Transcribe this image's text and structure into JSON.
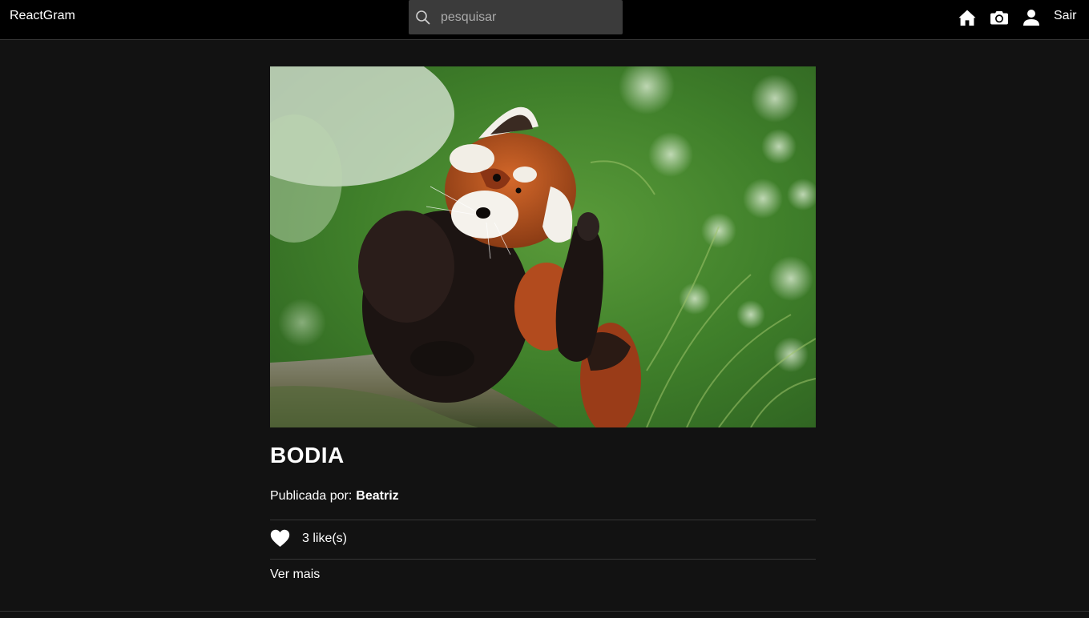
{
  "navbar": {
    "brand": "ReactGram",
    "search_placeholder": "pesquisar",
    "search_value": "",
    "icons": [
      "home-icon",
      "camera-icon",
      "user-icon"
    ],
    "logout_label": "Sair"
  },
  "photo": {
    "image_subject": "red-panda",
    "title": "BODIA",
    "posted_by_label": "Publicada por:",
    "author": "Beatriz",
    "likes_text": "3 like(s)",
    "see_more_label": "Ver mais"
  },
  "colors": {
    "background": "#121212",
    "navbar": "#000000",
    "search_bg": "#3b3b3b",
    "divider": "#363636",
    "text": "#ffffff"
  }
}
